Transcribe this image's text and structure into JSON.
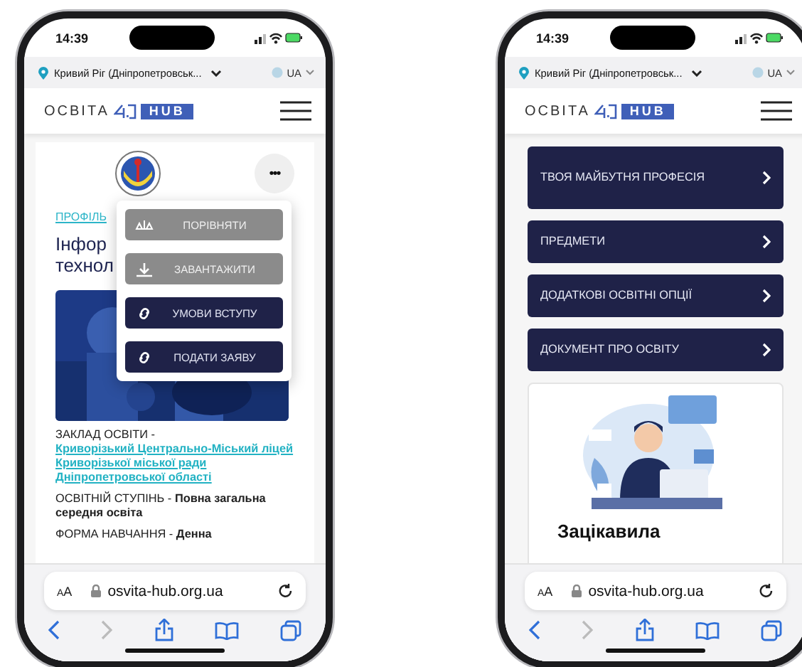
{
  "phones": [
    {
      "status_bar": {
        "time": "14:39"
      },
      "location_bar": {
        "city": "Кривий Ріг (Дніпропетровськ...",
        "language": "UA"
      },
      "header": {
        "logo_word": "ОСВІТА",
        "logo_badge": "HUB"
      },
      "content": {
        "kind": "profile",
        "more_button": "•••",
        "menu": [
          {
            "kind": "compare",
            "label": "ПОРІВНЯТИ",
            "disabled": true
          },
          {
            "kind": "download",
            "label": "ЗАВАНТАЖИТИ",
            "disabled": true
          },
          {
            "kind": "link",
            "label": "УМОВИ ВСТУПУ",
            "disabled": false
          },
          {
            "kind": "link",
            "label": "ПОДАТИ ЗАЯВУ",
            "disabled": false
          }
        ],
        "tag": "ПРОФІЛЬ",
        "title": [
          "Інфор",
          "технол"
        ],
        "facts": [
          {
            "label": "ЗАКЛАД ОСВІТИ - ",
            "value": "Криворізький Центрально-Міський ліцей Криворізької міської ради Дніпропетровської області",
            "link": true
          },
          {
            "label": "ОСВІТНІЙ СТУПІНЬ - ",
            "value": "Повна загальна середня освіта",
            "link": false
          },
          {
            "label": "ФОРМА НАВЧАННЯ - ",
            "value": "Денна",
            "link": false
          }
        ]
      },
      "browser": {
        "text_size": "AA",
        "url": "osvita-hub.org.ua"
      }
    },
    {
      "status_bar": {
        "time": "14:39"
      },
      "location_bar": {
        "city": "Кривий Ріг (Дніпропетровськ...",
        "language": "UA"
      },
      "header": {
        "logo_word": "ОСВІТА",
        "logo_badge": "HUB"
      },
      "content": {
        "kind": "sections",
        "buttons": [
          {
            "label": "ТВОЯ МАЙБУТНЯ ПРОФЕСІЯ"
          },
          {
            "label": "ПРЕДМЕТИ"
          },
          {
            "label": "ДОДАТКОВІ ОСВІТНІ ОПЦІЇ"
          },
          {
            "label": "ДОКУМЕНТ ПРО ОСВІТУ"
          }
        ],
        "card": {
          "title": "Зацікавила"
        }
      },
      "browser": {
        "text_size": "AA",
        "url": "osvita-hub.org.ua"
      }
    }
  ]
}
